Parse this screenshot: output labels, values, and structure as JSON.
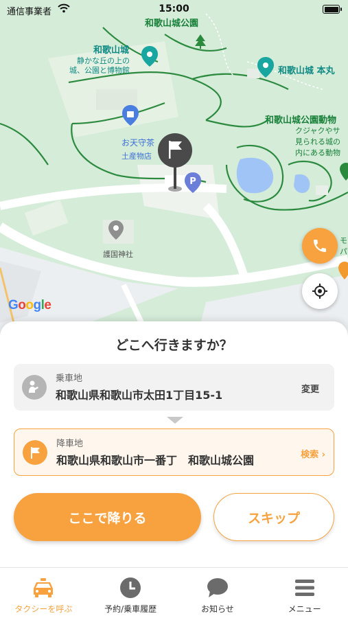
{
  "status_bar": {
    "carrier": "通信事業者",
    "time": "15:00"
  },
  "map": {
    "labels": {
      "park_top": "和歌山城公園",
      "castle_name": "和歌山城",
      "castle_desc_1": "静かな丘の上の",
      "castle_desc_2": "城、公園と博物館",
      "castle_keep": "和歌山城 本丸",
      "zoo_name": "和歌山城公園動物",
      "zoo_desc_1": "クジャクやサ",
      "zoo_desc_2": "見られる城の",
      "zoo_desc_3": "内にある動物",
      "shop_name": "お天守茶",
      "shop_category": "土産物店",
      "shrine": "護国神社",
      "edge_char_1": "モ",
      "edge_char_2": "パ"
    },
    "logo": [
      "G",
      "o",
      "o",
      "g",
      "l",
      "e"
    ],
    "icons": {
      "center_pin": "flag-pin-icon",
      "parking": "parking-icon",
      "phone": "phone-icon",
      "locate": "crosshair-icon"
    }
  },
  "sheet": {
    "title": "どこへ行きますか？",
    "pickup": {
      "label": "乗車地",
      "address": "和歌山県和歌山市太田1丁目15-1",
      "action": "変更"
    },
    "dropoff": {
      "label": "降車地",
      "address": "和歌山県和歌山市一番丁　和歌山城公園",
      "action": "検索 ›"
    },
    "buttons": {
      "primary": "ここで降りる",
      "secondary": "スキップ"
    }
  },
  "tabbar": {
    "items": [
      {
        "label": "タクシーを呼ぶ",
        "icon": "taxi-icon",
        "active": true
      },
      {
        "label": "予約/乗車履歴",
        "icon": "clock-icon",
        "active": false
      },
      {
        "label": "お知らせ",
        "icon": "chat-bubble-icon",
        "active": false
      },
      {
        "label": "メニュー",
        "icon": "menu-icon",
        "active": false
      }
    ]
  },
  "colors": {
    "accent": "#f7a23f",
    "map_green": "#d5ecd9",
    "park_text": "#188038",
    "poi_teal": "#0f8a84",
    "shop_blue": "#3b6fd6"
  }
}
